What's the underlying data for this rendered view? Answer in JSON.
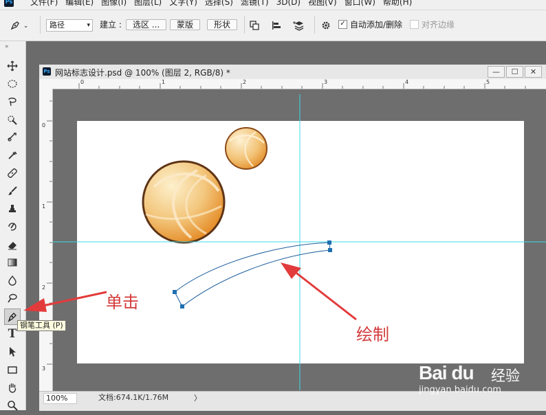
{
  "app": {
    "logo": "Ps"
  },
  "menu": [
    "文件(F)",
    "编辑(E)",
    "图像(I)",
    "图层(L)",
    "文字(Y)",
    "选择(S)",
    "滤镜(T)",
    "3D(D)",
    "视图(V)",
    "窗口(W)",
    "帮助(H)"
  ],
  "options": {
    "mode_select": "路径",
    "build_label": "建立 :",
    "selection_btn": "选区 ...",
    "mask_btn": "蒙版",
    "shape_btn": "形状",
    "auto_add_delete": "自动添加/删除",
    "align_edges": "对齐边缘",
    "auto_add_delete_checked": true,
    "align_edges_checked": false
  },
  "tooltip": "钢笔工具 (P)",
  "document": {
    "title": "网站标志设计.psd @ 100% (图层 2, RGB/8) *",
    "ruler_h": [
      "0",
      "1",
      "2",
      "3",
      "4",
      "5"
    ],
    "ruler_v": [
      "0",
      "1",
      "2",
      "3"
    ]
  },
  "status": {
    "zoom": "100%",
    "doc_size": "文档:674.1K/1.76M",
    "arrow": "〉"
  },
  "annotations": {
    "click": "单击",
    "draw": "绘制"
  },
  "watermark": {
    "brand": "Bai du",
    "sub": "经验",
    "url": "jingyan.baidu.com"
  },
  "colors": {
    "guide": "#3fd9ea",
    "arrow": "#e23b3b",
    "path": "#1e5f9e",
    "ball_dark": "#e5902a",
    "ball_light": "#fbe3b2"
  }
}
